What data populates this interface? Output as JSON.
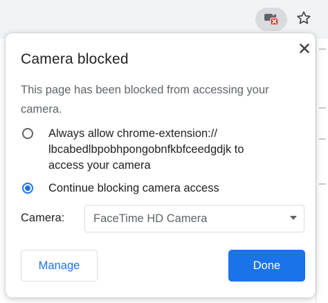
{
  "toolbar": {
    "camera_icon": "camera-blocked-icon",
    "star_icon": "bookmark-star-icon"
  },
  "popup": {
    "title": "Camera blocked",
    "close_icon": "close-icon",
    "description_lines": [
      "This page has been blocked from accessing your",
      "camera."
    ],
    "options": [
      {
        "lines": [
          "Always allow chrome-extension://",
          "lbcabedlbpobhpongobnfkbfceedgdjk to",
          "access your camera"
        ],
        "selected": false
      },
      {
        "lines": [
          "Continue blocking camera access"
        ],
        "selected": true
      }
    ],
    "camera_label": "Camera:",
    "camera_select": {
      "value": "FaceTime HD Camera"
    },
    "manage_label": "Manage",
    "done_label": "Done"
  },
  "colors": {
    "accent": "#1a73e8",
    "blocked_badge": "#d93025"
  }
}
